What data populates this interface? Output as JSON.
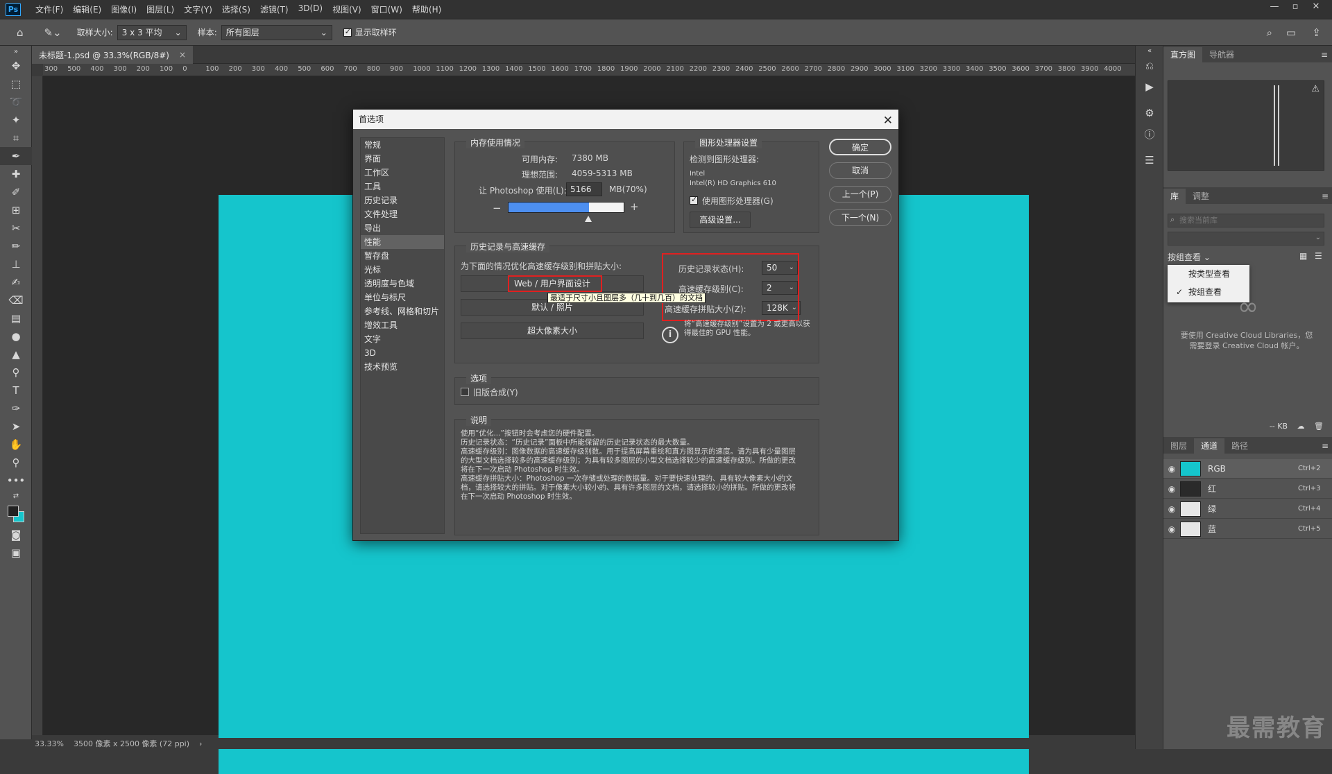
{
  "app": {
    "logo": "Ps",
    "menu": [
      "文件(F)",
      "编辑(E)",
      "图像(I)",
      "图层(L)",
      "文字(Y)",
      "选择(S)",
      "滤镜(T)",
      "3D(D)",
      "视图(V)",
      "窗口(W)",
      "帮助(H)"
    ],
    "window_controls": [
      "—",
      "▫",
      "✕"
    ]
  },
  "options_bar": {
    "sample_size_label": "取样大小:",
    "sample_size_value": "3 x 3 平均",
    "sample_label": "样本:",
    "sample_value": "所有图层",
    "show_ring_label": "显示取样环"
  },
  "document": {
    "tab_title": "未标题-1.psd @ 33.3%(RGB/8#)",
    "tab_close": "×",
    "canvas_color": "#15c5cc",
    "ruler_ticks": [
      "300",
      "500",
      "400",
      "300",
      "200",
      "100",
      "0",
      "100",
      "200",
      "300",
      "400",
      "500",
      "600",
      "700",
      "800",
      "900",
      "1000",
      "1100",
      "1200",
      "1300",
      "1400",
      "1500",
      "1600",
      "1700",
      "1800",
      "1900",
      "2000",
      "2100",
      "2200",
      "2300",
      "2400",
      "2500",
      "2600",
      "2700",
      "2800",
      "2900",
      "3000",
      "3100",
      "3200",
      "3300",
      "3400",
      "3500",
      "3600",
      "3700",
      "3800",
      "3900",
      "4000"
    ],
    "status_zoom": "33.33%",
    "status_info": "3500 像素 x 2500 像素 (72 ppi)",
    "status_arrow": "›"
  },
  "right_panel": {
    "top_tabs": [
      "直方图",
      "导航器"
    ],
    "lib_tabs": [
      "库",
      "调整"
    ],
    "lib_search_placeholder": "搜索当前库",
    "group_view_label": "按组查看 ⌄",
    "view_menu": [
      {
        "label": "按类型查看",
        "checked": false
      },
      {
        "label": "按组查看",
        "checked": true
      }
    ],
    "cc_message": "要使用 Creative Cloud Libraries，您需要登录 Creative Cloud 帐户。",
    "kb": "-- KB",
    "bottom_tabs": [
      "图层",
      "通道",
      "路径"
    ],
    "channels": [
      {
        "name": "RGB",
        "key": "Ctrl+2",
        "color": "#15c5cc"
      },
      {
        "name": "红",
        "key": "Ctrl+3",
        "color": "#2a2a2a"
      },
      {
        "name": "绿",
        "key": "Ctrl+4",
        "color": "#e6e6e6"
      },
      {
        "name": "蓝",
        "key": "Ctrl+5",
        "color": "#e6e6e6"
      }
    ],
    "watermark": "最需教育"
  },
  "dialog": {
    "title": "首选项",
    "nav": [
      "常规",
      "界面",
      "工作区",
      "工具",
      "历史记录",
      "文件处理",
      "导出",
      "性能",
      "暂存盘",
      "光标",
      "透明度与色域",
      "单位与标尺",
      "参考线、网格和切片",
      "增效工具",
      "文字",
      "3D",
      "技术预览"
    ],
    "active_nav": "性能",
    "memory": {
      "title": "内存使用情况",
      "available_label": "可用内存:",
      "available_value": "7380 MB",
      "ideal_label": "理想范围:",
      "ideal_value": "4059-5313 MB",
      "let_label": "让 Photoshop 使用(L):",
      "let_value": "5166",
      "let_unit": "MB(70%)",
      "minus": "−",
      "plus": "+",
      "slider_fraction": 0.7
    },
    "gpu": {
      "title": "图形处理器设置",
      "detected_label": "检测到图形处理器:",
      "vendor": "Intel",
      "model": "Intel(R) HD Graphics 610",
      "use_gpu_label": "使用图形处理器(G)",
      "advanced_button": "高级设置..."
    },
    "buttons": {
      "ok": "确定",
      "cancel": "取消",
      "prev": "上一个(P)",
      "next": "下一个(N)"
    },
    "history_cache": {
      "title": "历史记录与高速缓存",
      "optimize_label": "为下面的情况优化高速缓存级别和拼贴大小:",
      "presets": [
        "Web / 用户界面设计",
        "默认 / 照片",
        "超大像素大小"
      ],
      "tooltip": "最适于尺寸小且图层多（几十到几百）的文档",
      "history_states_label": "历史记录状态(H):",
      "history_states_value": "50",
      "cache_levels_label": "高速缓存级别(C):",
      "cache_levels_value": "2",
      "tile_size_label": "高速缓存拼贴大小(Z):",
      "tile_size_value": "128K",
      "tip": "将“高速缓存级别”设置为 2 或更高以获得最佳的 GPU 性能。",
      "info_icon": "i"
    },
    "options": {
      "title": "选项",
      "legacy_label": "旧版合成(Y)"
    },
    "description": {
      "title": "说明",
      "text": "使用“优化...”按钮时会考虑您的硬件配置。\n历史记录状态：“历史记录”面板中所能保留的历史记录状态的最大数量。\n高速缓存级别：图像数据的高速缓存级别数。用于提高屏幕重绘和直方图显示的速度。请为具有少量图层的大型文档选择较多的高速缓存级别；为具有较多图层的小型文档选择较少的高速缓存级别。所做的更改将在下一次启动 Photoshop 时生效。\n高速缓存拼贴大小：Photoshop 一次存储或处理的数据量。对于要快速处理的、具有较大像素大小的文档，请选择较大的拼贴。对于像素大小较小的、具有许多图层的文档，请选择较小的拼贴。所做的更改将在下一次启动 Photoshop 时生效。"
    }
  }
}
